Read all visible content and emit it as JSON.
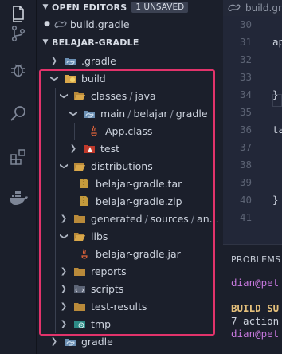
{
  "activity_bar": {
    "icons": [
      "files-icon",
      "source-control-icon",
      "debug-icon",
      "search-icon",
      "extensions-icon",
      "docker-icon"
    ]
  },
  "open_editors": {
    "title": "OPEN EDITORS",
    "badge": "1 UNSAVED",
    "file": "build.gradle"
  },
  "project": {
    "title": "BELAJAR-GRADLE",
    "items": {
      "gradle_dir": ".gradle",
      "build": "build",
      "classes": "classes",
      "java": "java",
      "main": "main",
      "belajar": "belajar",
      "gradle_pkg": "gradle",
      "app_class": "App.class",
      "test": "test",
      "distributions": "distributions",
      "tar": "belajar-gradle.tar",
      "zip": "belajar-gradle.zip",
      "generated": "generated",
      "sources": "sources",
      "generated_more": "an...",
      "libs": "libs",
      "jar": "belajar-gradle.jar",
      "reports": "reports",
      "scripts": "scripts",
      "test_results": "test-results",
      "tmp": "tmp",
      "gradle_bottom": "gradle"
    },
    "separator": "/"
  },
  "editor": {
    "tab_label": "build.gradl",
    "line_numbers": [
      "30",
      "31",
      "32",
      "33",
      "34",
      "35",
      "36",
      "37",
      "38",
      "39",
      "40",
      "41"
    ],
    "code": {
      "l31": "ap",
      "l34": "}",
      "l36": "ta",
      "l41": "}"
    }
  },
  "panel": {
    "title": "PROBLEMS",
    "lines": [
      "dian@pet",
      "BUILD SU",
      "7 action",
      "dian@pet"
    ]
  },
  "colors": {
    "highlight_border": "#e2336b",
    "folder": "#d9a74a",
    "terminal_user": "#c678dd",
    "build_success": "#e5c07b"
  }
}
